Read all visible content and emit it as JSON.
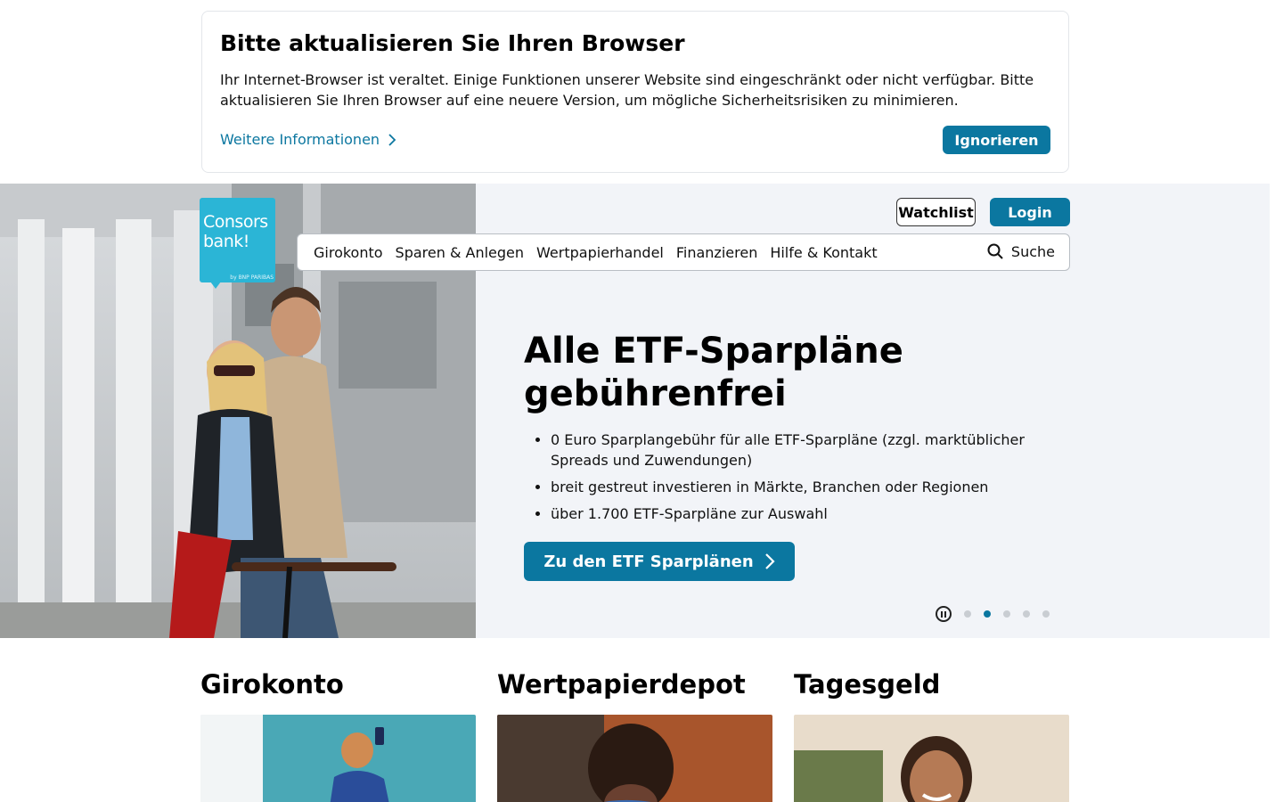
{
  "browser_warning": {
    "title": "Bitte aktualisieren Sie Ihren Browser",
    "text": "Ihr Internet-Browser ist veraltet. Einige Funktionen unserer Website sind eingeschränkt oder nicht verfügbar. Bitte aktualisieren Sie Ihren Browser auf eine neuere Version, um mögliche Sicherheitsrisiken zu minimieren.",
    "more_link": "Weitere Informationen",
    "ignore_button": "Ignorieren"
  },
  "header": {
    "logo_line1": "Consors",
    "logo_line2": "bank!",
    "logo_byline": "by BNP PARIBAS",
    "watchlist_button": "Watchlist",
    "login_button": "Login",
    "nav": [
      "Girokonto",
      "Sparen & Anlegen",
      "Wertpapierhandel",
      "Finanzieren",
      "Hilfe & Kontakt"
    ],
    "search_label": "Suche"
  },
  "hero": {
    "title": "Alle ETF-Sparpläne gebührenfrei",
    "bullets": [
      "0 Euro Sparplangebühr für alle ETF-Sparpläne (zzgl. marktüblicher Spreads und Zuwendungen)",
      "breit gestreut investieren in Märkte, Branchen oder Regionen",
      "über 1.700 ETF-Sparpläne zur Auswahl"
    ],
    "cta": "Zu den ETF Sparplänen",
    "slides_total": 5,
    "slide_active": 2
  },
  "cards": [
    {
      "title": "Girokonto"
    },
    {
      "title": "Wertpapierdepot"
    },
    {
      "title": "Tagesgeld"
    }
  ],
  "colors": {
    "brand": "#0b77a0",
    "logo": "#2bb5d6",
    "hero_bg": "#f2f4f8"
  }
}
